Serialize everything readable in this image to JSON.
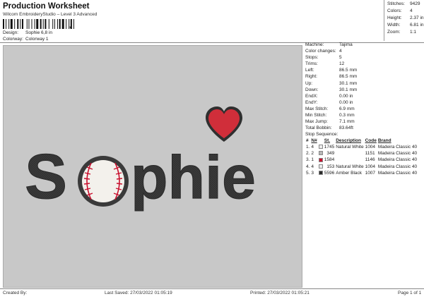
{
  "header": {
    "title": "Production Worksheet",
    "subtitle": "Wilcom EmbroideryStudio – Level 3 Advanced",
    "barcode_mark": ",",
    "design_label": "Design:",
    "design_value": "Sophie 6,8 in",
    "colorway_label": "Colorway:",
    "colorway_value": "Colorway 1"
  },
  "stats": [
    {
      "label": "Stitches:",
      "value": "9429"
    },
    {
      "label": "Colors:",
      "value": "4"
    },
    {
      "label": "Height:",
      "value": "2.37 in"
    },
    {
      "label": "Width:",
      "value": "6.81 in"
    },
    {
      "label": "Zoom:",
      "value": "1:1"
    }
  ],
  "specs": [
    {
      "label": "Machine:",
      "value": "Tajima"
    },
    {
      "label": "Color changes:",
      "value": "4"
    },
    {
      "label": "Stops:",
      "value": "5"
    },
    {
      "label": "Trims:",
      "value": "12"
    },
    {
      "label": "Left:",
      "value": "86.5 mm"
    },
    {
      "label": "Right:",
      "value": "86.5 mm"
    },
    {
      "label": "Up:",
      "value": "30.1 mm"
    },
    {
      "label": "Down:",
      "value": "30.1 mm"
    },
    {
      "label": "EndX:",
      "value": "0.00 in"
    },
    {
      "label": "EndY:",
      "value": "0.00 in"
    },
    {
      "label": "Max Stitch:",
      "value": "6.9 mm"
    },
    {
      "label": "Min Stitch:",
      "value": "0.3 mm"
    },
    {
      "label": "Max Jump:",
      "value": "7.1 mm"
    },
    {
      "label": "Total Bobbin:",
      "value": "83.64ft"
    }
  ],
  "sequence": {
    "title": "Stop Sequence:",
    "headers": [
      "#",
      "N#",
      "St.",
      "Description",
      "Code",
      "Brand"
    ],
    "rows": [
      {
        "num": "1.",
        "n": "4",
        "color": "#ececec",
        "st": "1745",
        "desc": "Natural White",
        "code": "1004",
        "brand": "Madeira Classic 40"
      },
      {
        "num": "2.",
        "n": "2",
        "color": "#b8b8b8",
        "st": "349",
        "desc": "",
        "code": "1151",
        "brand": "Madeira Classic 40"
      },
      {
        "num": "3.",
        "n": "1",
        "color": "#c8102e",
        "st": "1584",
        "desc": "",
        "code": "1146",
        "brand": "Madeira Classic 40"
      },
      {
        "num": "4.",
        "n": "4",
        "color": "#ececec",
        "st": "153",
        "desc": "Natural White",
        "code": "1004",
        "brand": "Madeira Classic 40"
      },
      {
        "num": "5.",
        "n": "3",
        "color": "#2b2b2b",
        "st": "5596",
        "desc": "Amber Black",
        "code": "1007",
        "brand": "Madeira Classic 40"
      }
    ]
  },
  "design": {
    "word_rest": "phie",
    "colors": {
      "black": "#3a3a3a",
      "ball": "#f3f1ec",
      "seam": "#c8102e",
      "heart": "#d9333f"
    }
  },
  "footer": {
    "created_by": "Created By:",
    "last_saved": "Last Saved: 27/03/2022 01:05:19",
    "printed": "Printed: 27/03/2022 01:05:21",
    "page": "Page 1 of 1"
  }
}
